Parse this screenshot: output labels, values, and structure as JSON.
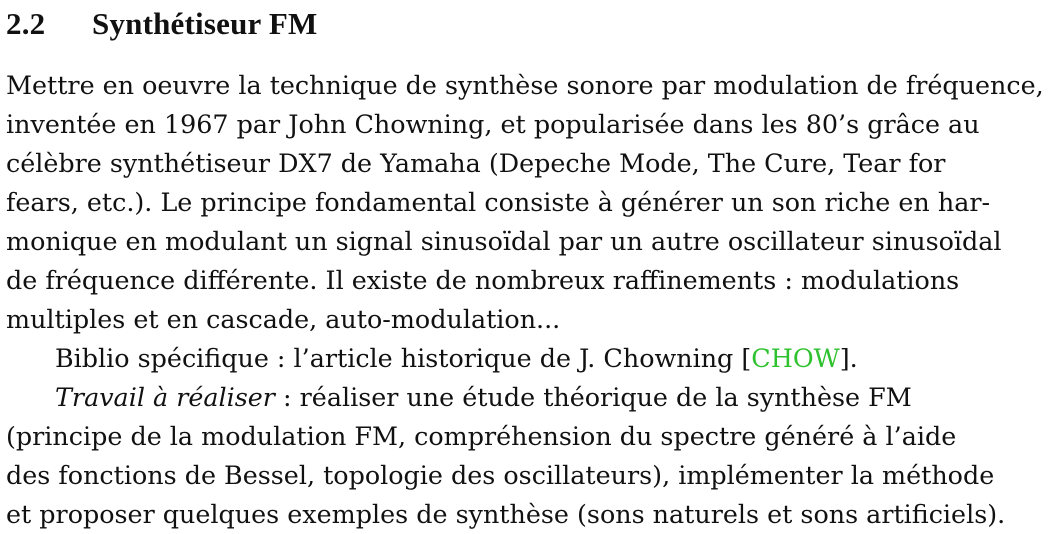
{
  "section": {
    "number": "2.2",
    "title": "Synthétiseur FM"
  },
  "paragraph1": {
    "lines": [
      "Mettre en oeuvre la technique de synthèse sonore par modulation de fréquence,",
      "inventée en 1967 par John Chowning, et popularisée dans les 80’s grâce au",
      "célèbre synthétiseur DX7 de Yamaha (Depeche Mode, The Cure, Tear for",
      "fears, etc.). Le principe fondamental consiste à générer un son riche en har-",
      "monique en modulant un signal sinusoïdal par un autre oscillateur sinusoïdal",
      "de fréquence différente. Il existe de nombreux raffinements : modulations",
      "multiples et en cascade, auto-modulation..."
    ]
  },
  "paragraph2": {
    "text_before": "Biblio spécifique : l’article historique de J. Chowning [",
    "citation": "CHOW",
    "text_after": "]."
  },
  "paragraph3": {
    "label": "Travail à réaliser",
    "first_line_rest": " : réaliser une étude théorique de la synthèse FM",
    "lines": [
      "(principe de la modulation FM, compréhension du spectre généré à l’aide",
      "des fonctions de Bessel, topologie des oscillateurs), implémenter la méthode",
      "et proposer quelques exemples de synthèse (sons naturels et sons artificiels)."
    ]
  },
  "colors": {
    "citation_link": "#2ec22e",
    "text": "#111111"
  }
}
